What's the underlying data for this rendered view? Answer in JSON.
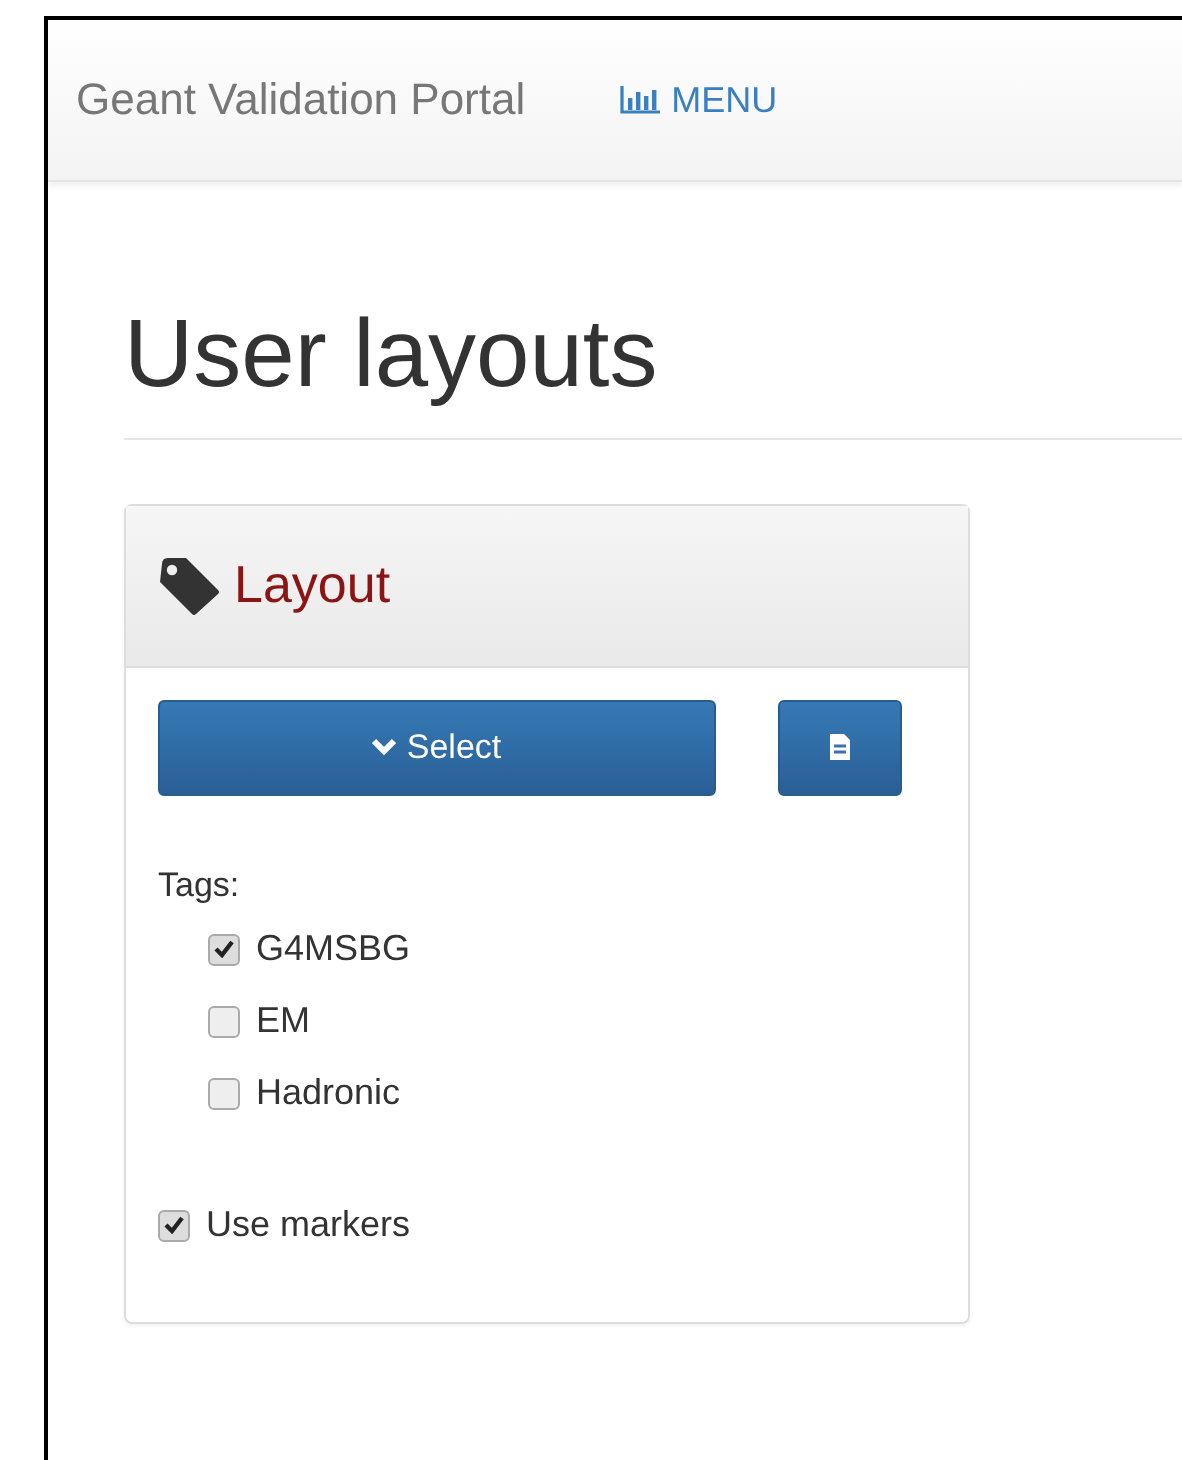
{
  "navbar": {
    "brand": "Geant Validation Portal",
    "menu": "MENU"
  },
  "page": {
    "title": "User layouts"
  },
  "panel": {
    "title": "Layout",
    "select_button": "Select",
    "tags_label": "Tags:",
    "tags": [
      {
        "label": "G4MSBG",
        "checked": true
      },
      {
        "label": "EM",
        "checked": false
      },
      {
        "label": "Hadronic",
        "checked": false
      }
    ],
    "use_markers": {
      "label": "Use markers",
      "checked": true
    }
  }
}
